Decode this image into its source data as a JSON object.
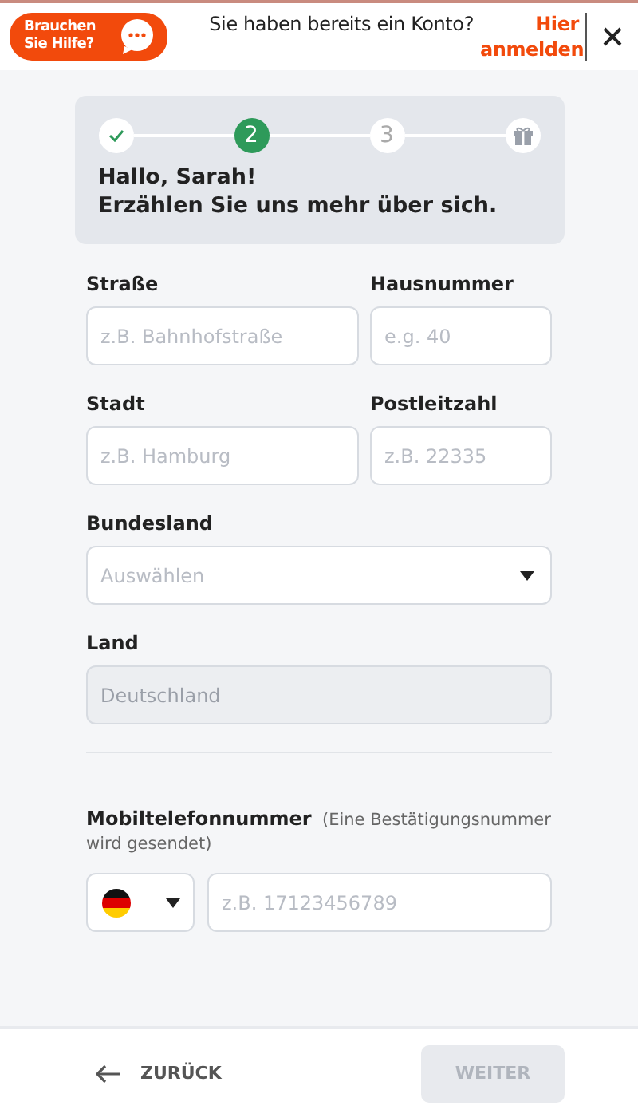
{
  "header": {
    "help_button": "Brauchen Sie Hilfe?",
    "account_prompt": "Sie haben bereits ein Konto?",
    "login_link": "Hier anmelden"
  },
  "stepper": {
    "steps": [
      {
        "kind": "done"
      },
      {
        "kind": "current",
        "label": "2"
      },
      {
        "kind": "upcoming",
        "label": "3"
      },
      {
        "kind": "gift"
      }
    ],
    "greeting": "Hallo, Sarah!",
    "subtitle": "Erzählen Sie uns mehr über sich."
  },
  "rows": [
    {
      "fields": [
        {
          "label": "Straße",
          "placeholder": "z.B. Bahnhofstraße",
          "kind": "text"
        },
        {
          "label": "Hausnummer",
          "placeholder": "e.g. 40",
          "kind": "text"
        }
      ]
    },
    {
      "fields": [
        {
          "label": "Stadt",
          "placeholder": "z.B. Hamburg",
          "kind": "text"
        },
        {
          "label": "Postleitzahl",
          "placeholder": "z.B. 22335",
          "kind": "text"
        }
      ]
    },
    {
      "fields": [
        {
          "label": "Bundesland",
          "placeholder": "Auswählen",
          "kind": "select"
        }
      ]
    },
    {
      "fields": [
        {
          "label": "Land",
          "value": "Deutschland",
          "kind": "text",
          "disabled": true
        }
      ]
    }
  ],
  "phone": {
    "label": "**Mobiltelefonnummer**  (Eine Bestätigungsnummer wird gesendet)",
    "placeholder": "z.B. 17123456789"
  },
  "footer": {
    "back": "ZURÜCK",
    "next": {
      "label": "WEITER",
      "disabled": true
    }
  }
}
